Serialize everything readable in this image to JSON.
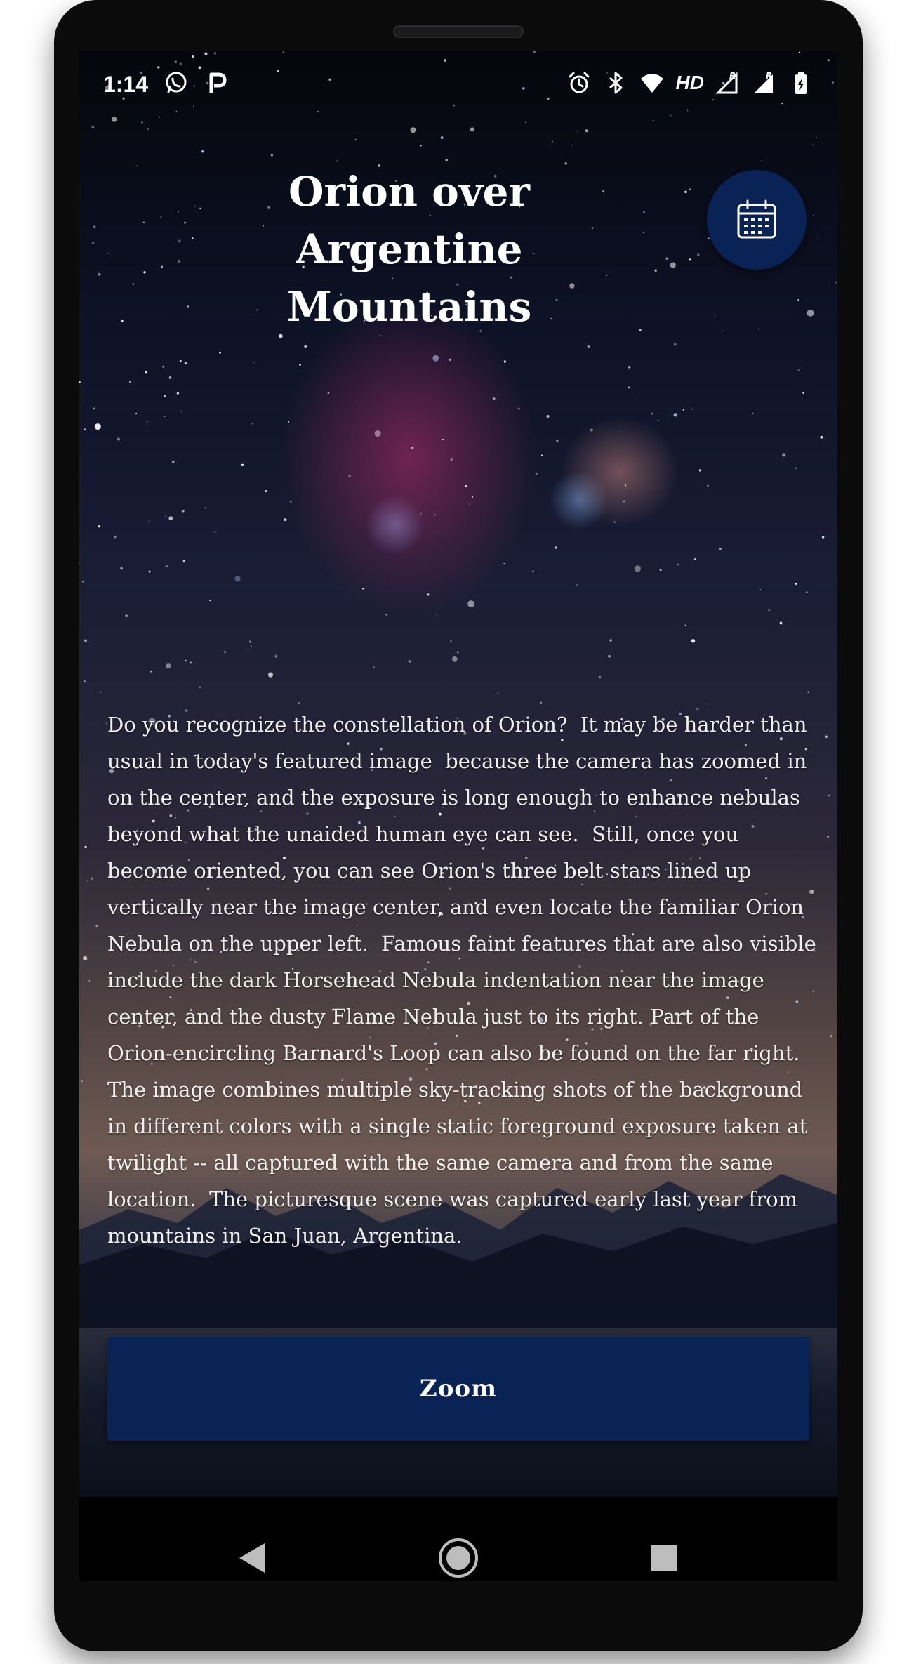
{
  "status_bar": {
    "time": "1:14",
    "network_label": "HD",
    "icons": [
      "whatsapp-icon",
      "parking-p-icon",
      "alarm-icon",
      "bluetooth-icon",
      "wifi-icon",
      "signal-icon",
      "signal-icon",
      "battery-icon"
    ]
  },
  "header": {
    "title": "Orion over Argentine Mountains",
    "calendar_icon": "calendar-icon"
  },
  "main": {
    "description": "Do you recognize the constellation of Orion?  It may be harder than usual in today's featured image  because the camera has zoomed in on the center, and the exposure is long enough to enhance nebulas beyond what the unaided human eye can see.  Still, once you become oriented, you can see Orion's three belt stars lined up vertically near the image center, and even locate the familiar Orion Nebula on the upper left.  Famous faint features that are also visible include the dark Horsehead Nebula indentation near the image center, and the dusty Flame Nebula just to its right. Part of the Orion-encircling Barnard's Loop can also be found on the far right.  The image combines multiple sky-tracking shots of the background in different colors with a single static foreground exposure taken at twilight -- all captured with the same camera and from the same location.  The picturesque scene was captured early last year from mountains in San Juan, Argentina.",
    "zoom_label": "Zoom"
  },
  "nav_bar": {
    "back_icon": "back-triangle-icon",
    "home_icon": "home-circle-icon",
    "recents_icon": "recents-square-icon"
  },
  "colors": {
    "accent": "#0a2356",
    "text": "#f2f0ee"
  }
}
